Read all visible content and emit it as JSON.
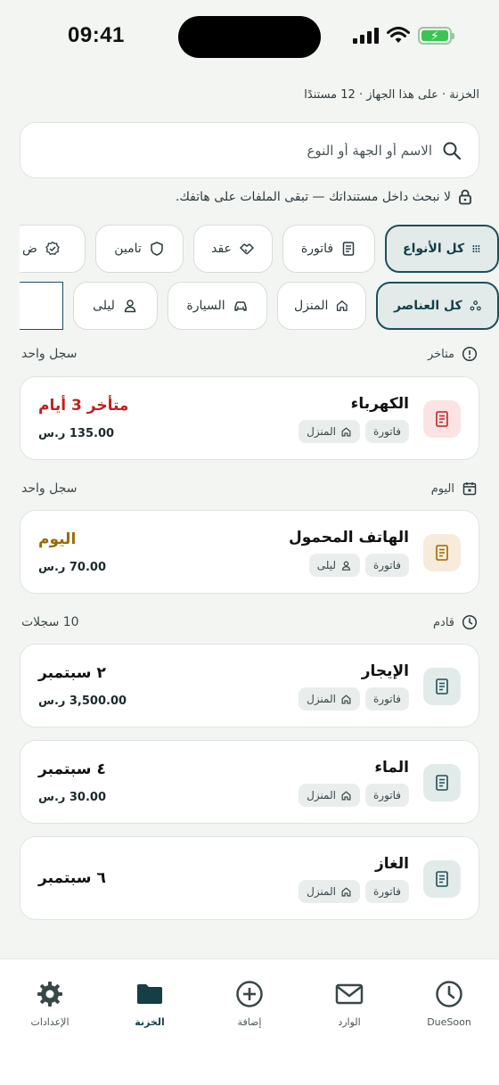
{
  "status_bar": {
    "time": "09:41"
  },
  "header": {
    "context": "الخزنة · على هذا الجهاز · 12 مستندًا"
  },
  "search": {
    "placeholder": "الاسم أو الجهة أو النوع"
  },
  "privacy_note": "لا نبحث داخل مستنداتك — تبقى الملفات على هاتفك.",
  "type_filters": [
    {
      "label": "كل الأنواع",
      "icon": "grid-icon",
      "active": true
    },
    {
      "label": "فاتورة",
      "icon": "receipt-icon",
      "active": false
    },
    {
      "label": "عقد",
      "icon": "handshake-icon",
      "active": false
    },
    {
      "label": "تامين",
      "icon": "shield-icon",
      "active": false
    },
    {
      "label": "ض",
      "icon": "badge-check-icon",
      "active": false
    }
  ],
  "scope_filters": [
    {
      "label": "كل العناصر",
      "icon": "nodes-icon",
      "active": true
    },
    {
      "label": "المنزل",
      "icon": "home-icon",
      "active": false
    },
    {
      "label": "السيارة",
      "icon": "car-icon",
      "active": false
    },
    {
      "label": "ليلى",
      "icon": "person-icon",
      "active": false
    },
    {
      "label": "",
      "icon": "sliders-icon",
      "active": false
    }
  ],
  "sections": {
    "overdue": {
      "label": "متاخر",
      "count": "سجل واحد"
    },
    "today": {
      "label": "اليوم",
      "count": "سجل واحد"
    },
    "upcoming": {
      "label": "قادم",
      "count": "10 سجلات"
    }
  },
  "items": [
    {
      "title": "الكهرباء",
      "type_tag": "فاتورة",
      "owner_tag": "المنزل",
      "due": "متأخر 3 أيام",
      "amount": "135.00 ر.س",
      "icon": "receipt-icon"
    },
    {
      "title": "الهاتف المحمول",
      "type_tag": "فاتورة",
      "owner_tag": "ليلى",
      "due": "اليوم",
      "amount": "70.00 ر.س",
      "icon": "receipt-icon"
    },
    {
      "title": "الإيجار",
      "type_tag": "فاتورة",
      "owner_tag": "المنزل",
      "due": "٢ سبتمبر",
      "amount": "3,500.00 ر.س",
      "icon": "receipt-icon"
    },
    {
      "title": "الماء",
      "type_tag": "فاتورة",
      "owner_tag": "المنزل",
      "due": "٤ سبتمبر",
      "amount": "30.00 ر.س",
      "icon": "receipt-icon"
    },
    {
      "title": "الغاز",
      "type_tag": "فاتورة",
      "owner_tag": "المنزل",
      "due": "٦ سبتمبر",
      "amount": "",
      "icon": "receipt-icon"
    }
  ],
  "colors": {
    "accent": "#1d4f5a",
    "overdue": "#c0211f",
    "today": "#9a6a00",
    "overdue_icon_bg": "#fbe3e4",
    "today_icon_bg": "#f7ebdc",
    "upcoming_icon_bg": "#e2ebea"
  },
  "tabs": [
    {
      "label": "الإعدادات",
      "icon": "gear-icon",
      "active": false
    },
    {
      "label": "الخزنة",
      "icon": "folder-icon",
      "active": true
    },
    {
      "label": "إضافة",
      "icon": "plus-circle-icon",
      "active": false
    },
    {
      "label": "الوارد",
      "icon": "mail-icon",
      "active": false
    },
    {
      "label": "DueSoon",
      "icon": "clock-icon",
      "active": false
    }
  ]
}
